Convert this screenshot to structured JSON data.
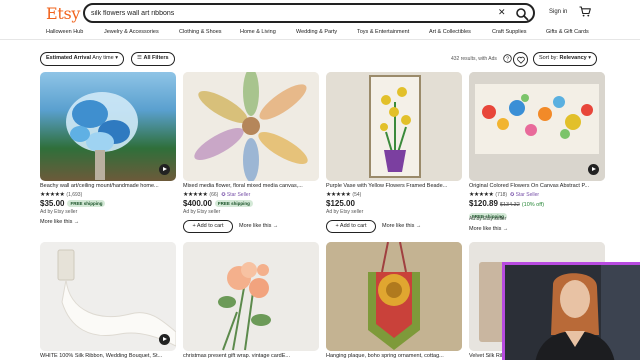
{
  "header": {
    "logo": "Etsy",
    "search_value": "silk flowers wall art ribbons",
    "clear_glyph": "✕",
    "signin": "Sign in",
    "icons": {
      "search": "search-icon",
      "cart": "cart-icon"
    }
  },
  "catnav": [
    "Halloween Hub",
    "Jewelry & Accessories",
    "Clothing & Shoes",
    "Home & Living",
    "Wedding & Party",
    "Toys & Entertainment",
    "Art & Collectibles",
    "Craft Supplies",
    "Gifts & Gift Cards"
  ],
  "filters": {
    "arrival_label": "Estimated Arrival",
    "arrival_value": "Any time",
    "all_filters": "All Filters",
    "results": "432 results, with Ads",
    "sort_label": "Sort by:",
    "sort_value": "Relevancy"
  },
  "products": [
    {
      "title": "Beachy wall art/ceiling mount/handmade home...",
      "stars": "★★★★★",
      "count": "(1,693)",
      "price": "$35.00",
      "free": "FREE shipping",
      "adby": "Ad by Etsy seller",
      "more": "More like this →"
    },
    {
      "title": "Mixed media flower, floral mixed media canvas,...",
      "stars": "★★★★★",
      "count": "(66)",
      "star_seller": "✪ Star Seller",
      "price": "$400.00",
      "free": "FREE shipping",
      "adby": "Ad by Etsy seller",
      "addcart": "+ Add to cart",
      "more": "More like this →"
    },
    {
      "title": "Purple Vase with Yellow Flowers Framed Beade...",
      "stars": "★★★★★",
      "count": "(54)",
      "price": "$125.00",
      "adby": "Ad by Etsy seller",
      "addcart": "+ Add to cart",
      "more": "More like this →"
    },
    {
      "title": "Original Colored Flowers On Canvas Abstract P...",
      "stars": "★★★★★",
      "count": "(718)",
      "star_seller": "✪ Star Seller",
      "price": "$120.89",
      "orig": "$134.32",
      "off": "(10% off)",
      "free": "FREE shipping",
      "adby": "Ad by Etsy seller",
      "more": "More like this →"
    },
    {
      "title": "WHITE 100% Silk Ribbon, Wedding Bouquet, St..."
    },
    {
      "title": "christmas present    gift wrap.    vintage cardE..."
    },
    {
      "title": "Hanging plaque, boho spring ornament, cottag..."
    },
    {
      "title": "Velvet Silk Ribbon - 8 Colors - Hand Dyed Wi..."
    }
  ],
  "colors": {
    "brand": "#f1641e",
    "star_seller": "#7851a9",
    "free_bg": "#d4e9d7",
    "webcam_border": "#b84be0"
  }
}
